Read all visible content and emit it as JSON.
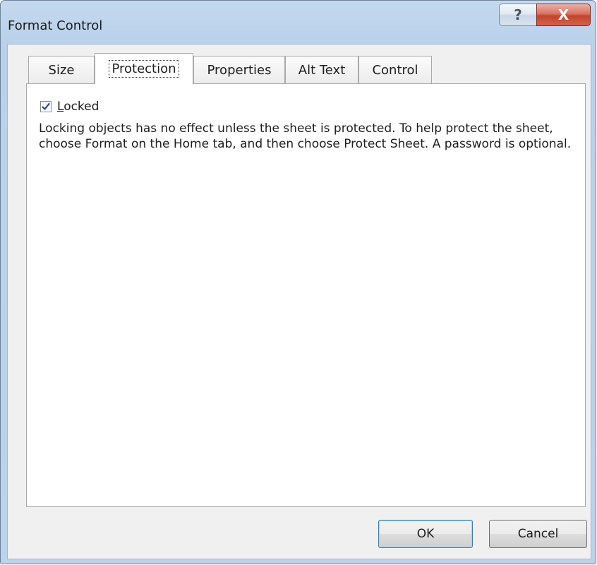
{
  "window": {
    "title": "Format Control",
    "help_glyph": "?",
    "close_glyph": "X"
  },
  "tabs": [
    {
      "label": "Size",
      "active": false
    },
    {
      "label": "Protection",
      "active": true
    },
    {
      "label": "Properties",
      "active": false
    },
    {
      "label": "Alt Text",
      "active": false
    },
    {
      "label": "Control",
      "active": false
    }
  ],
  "protection": {
    "locked": {
      "mnemonic": "L",
      "rest": "ocked",
      "checked": true
    },
    "description": "Locking objects has no effect unless the sheet is protected.  To help protect the sheet, choose Format on the Home tab, and then choose Protect Sheet.  A password is optional."
  },
  "buttons": {
    "ok": "OK",
    "cancel": "Cancel"
  },
  "colors": {
    "title_bar": "#b9d1ea",
    "close_button": "#c2442b",
    "dialog_background": "#f0f0f0",
    "panel_background": "#ffffff",
    "checkmark": "#2a4a7f",
    "default_button_border": "#3c7fb1"
  },
  "icons": {
    "help": "help-icon",
    "close": "close-icon",
    "checkmark": "checkmark-icon"
  }
}
